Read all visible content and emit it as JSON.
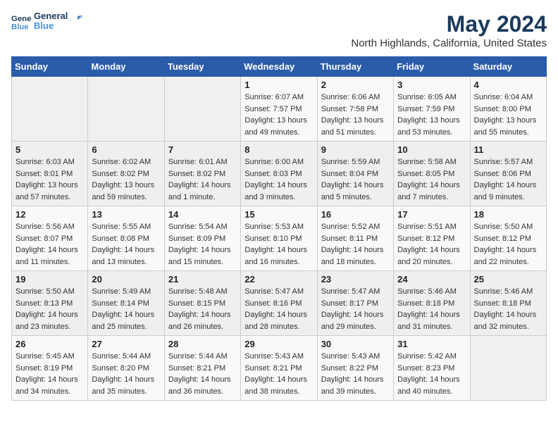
{
  "logo": {
    "line1": "General",
    "line2": "Blue"
  },
  "title": "May 2024",
  "subtitle": "North Highlands, California, United States",
  "weekdays": [
    "Sunday",
    "Monday",
    "Tuesday",
    "Wednesday",
    "Thursday",
    "Friday",
    "Saturday"
  ],
  "weeks": [
    [
      {
        "day": "",
        "sunrise": "",
        "sunset": "",
        "daylight": ""
      },
      {
        "day": "",
        "sunrise": "",
        "sunset": "",
        "daylight": ""
      },
      {
        "day": "",
        "sunrise": "",
        "sunset": "",
        "daylight": ""
      },
      {
        "day": "1",
        "sunrise": "Sunrise: 6:07 AM",
        "sunset": "Sunset: 7:57 PM",
        "daylight": "Daylight: 13 hours and 49 minutes."
      },
      {
        "day": "2",
        "sunrise": "Sunrise: 6:06 AM",
        "sunset": "Sunset: 7:58 PM",
        "daylight": "Daylight: 13 hours and 51 minutes."
      },
      {
        "day": "3",
        "sunrise": "Sunrise: 6:05 AM",
        "sunset": "Sunset: 7:59 PM",
        "daylight": "Daylight: 13 hours and 53 minutes."
      },
      {
        "day": "4",
        "sunrise": "Sunrise: 6:04 AM",
        "sunset": "Sunset: 8:00 PM",
        "daylight": "Daylight: 13 hours and 55 minutes."
      }
    ],
    [
      {
        "day": "5",
        "sunrise": "Sunrise: 6:03 AM",
        "sunset": "Sunset: 8:01 PM",
        "daylight": "Daylight: 13 hours and 57 minutes."
      },
      {
        "day": "6",
        "sunrise": "Sunrise: 6:02 AM",
        "sunset": "Sunset: 8:02 PM",
        "daylight": "Daylight: 13 hours and 59 minutes."
      },
      {
        "day": "7",
        "sunrise": "Sunrise: 6:01 AM",
        "sunset": "Sunset: 8:02 PM",
        "daylight": "Daylight: 14 hours and 1 minute."
      },
      {
        "day": "8",
        "sunrise": "Sunrise: 6:00 AM",
        "sunset": "Sunset: 8:03 PM",
        "daylight": "Daylight: 14 hours and 3 minutes."
      },
      {
        "day": "9",
        "sunrise": "Sunrise: 5:59 AM",
        "sunset": "Sunset: 8:04 PM",
        "daylight": "Daylight: 14 hours and 5 minutes."
      },
      {
        "day": "10",
        "sunrise": "Sunrise: 5:58 AM",
        "sunset": "Sunset: 8:05 PM",
        "daylight": "Daylight: 14 hours and 7 minutes."
      },
      {
        "day": "11",
        "sunrise": "Sunrise: 5:57 AM",
        "sunset": "Sunset: 8:06 PM",
        "daylight": "Daylight: 14 hours and 9 minutes."
      }
    ],
    [
      {
        "day": "12",
        "sunrise": "Sunrise: 5:56 AM",
        "sunset": "Sunset: 8:07 PM",
        "daylight": "Daylight: 14 hours and 11 minutes."
      },
      {
        "day": "13",
        "sunrise": "Sunrise: 5:55 AM",
        "sunset": "Sunset: 8:08 PM",
        "daylight": "Daylight: 14 hours and 13 minutes."
      },
      {
        "day": "14",
        "sunrise": "Sunrise: 5:54 AM",
        "sunset": "Sunset: 8:09 PM",
        "daylight": "Daylight: 14 hours and 15 minutes."
      },
      {
        "day": "15",
        "sunrise": "Sunrise: 5:53 AM",
        "sunset": "Sunset: 8:10 PM",
        "daylight": "Daylight: 14 hours and 16 minutes."
      },
      {
        "day": "16",
        "sunrise": "Sunrise: 5:52 AM",
        "sunset": "Sunset: 8:11 PM",
        "daylight": "Daylight: 14 hours and 18 minutes."
      },
      {
        "day": "17",
        "sunrise": "Sunrise: 5:51 AM",
        "sunset": "Sunset: 8:12 PM",
        "daylight": "Daylight: 14 hours and 20 minutes."
      },
      {
        "day": "18",
        "sunrise": "Sunrise: 5:50 AM",
        "sunset": "Sunset: 8:12 PM",
        "daylight": "Daylight: 14 hours and 22 minutes."
      }
    ],
    [
      {
        "day": "19",
        "sunrise": "Sunrise: 5:50 AM",
        "sunset": "Sunset: 8:13 PM",
        "daylight": "Daylight: 14 hours and 23 minutes."
      },
      {
        "day": "20",
        "sunrise": "Sunrise: 5:49 AM",
        "sunset": "Sunset: 8:14 PM",
        "daylight": "Daylight: 14 hours and 25 minutes."
      },
      {
        "day": "21",
        "sunrise": "Sunrise: 5:48 AM",
        "sunset": "Sunset: 8:15 PM",
        "daylight": "Daylight: 14 hours and 26 minutes."
      },
      {
        "day": "22",
        "sunrise": "Sunrise: 5:47 AM",
        "sunset": "Sunset: 8:16 PM",
        "daylight": "Daylight: 14 hours and 28 minutes."
      },
      {
        "day": "23",
        "sunrise": "Sunrise: 5:47 AM",
        "sunset": "Sunset: 8:17 PM",
        "daylight": "Daylight: 14 hours and 29 minutes."
      },
      {
        "day": "24",
        "sunrise": "Sunrise: 5:46 AM",
        "sunset": "Sunset: 8:18 PM",
        "daylight": "Daylight: 14 hours and 31 minutes."
      },
      {
        "day": "25",
        "sunrise": "Sunrise: 5:46 AM",
        "sunset": "Sunset: 8:18 PM",
        "daylight": "Daylight: 14 hours and 32 minutes."
      }
    ],
    [
      {
        "day": "26",
        "sunrise": "Sunrise: 5:45 AM",
        "sunset": "Sunset: 8:19 PM",
        "daylight": "Daylight: 14 hours and 34 minutes."
      },
      {
        "day": "27",
        "sunrise": "Sunrise: 5:44 AM",
        "sunset": "Sunset: 8:20 PM",
        "daylight": "Daylight: 14 hours and 35 minutes."
      },
      {
        "day": "28",
        "sunrise": "Sunrise: 5:44 AM",
        "sunset": "Sunset: 8:21 PM",
        "daylight": "Daylight: 14 hours and 36 minutes."
      },
      {
        "day": "29",
        "sunrise": "Sunrise: 5:43 AM",
        "sunset": "Sunset: 8:21 PM",
        "daylight": "Daylight: 14 hours and 38 minutes."
      },
      {
        "day": "30",
        "sunrise": "Sunrise: 5:43 AM",
        "sunset": "Sunset: 8:22 PM",
        "daylight": "Daylight: 14 hours and 39 minutes."
      },
      {
        "day": "31",
        "sunrise": "Sunrise: 5:42 AM",
        "sunset": "Sunset: 8:23 PM",
        "daylight": "Daylight: 14 hours and 40 minutes."
      },
      {
        "day": "",
        "sunrise": "",
        "sunset": "",
        "daylight": ""
      }
    ]
  ]
}
